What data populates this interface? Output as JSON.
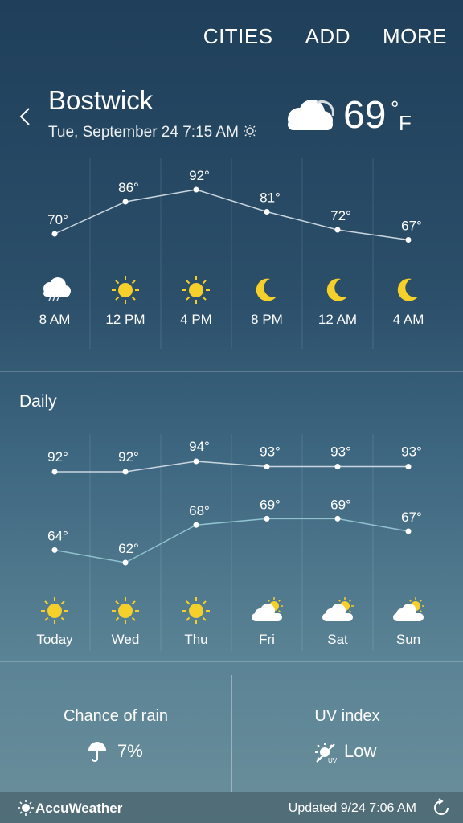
{
  "menu": {
    "cities": "CITIES",
    "add": "ADD",
    "more": "MORE"
  },
  "header": {
    "city": "Bostwick",
    "datetime": "Tue, September 24 7:15 AM",
    "current_temp": "69",
    "degree": "°",
    "unit": "F",
    "current_icon": "cloud-icon"
  },
  "hourly": [
    {
      "time": "8 AM",
      "temp": "70°",
      "value": 70,
      "icon": "rain-cloud-icon"
    },
    {
      "time": "12 PM",
      "temp": "86°",
      "value": 86,
      "icon": "sun-icon"
    },
    {
      "time": "4 PM",
      "temp": "92°",
      "value": 92,
      "icon": "sun-icon"
    },
    {
      "time": "8 PM",
      "temp": "81°",
      "value": 81,
      "icon": "moon-icon"
    },
    {
      "time": "12 AM",
      "temp": "72°",
      "value": 72,
      "icon": "moon-icon"
    },
    {
      "time": "4 AM",
      "temp": "67°",
      "value": 67,
      "icon": "moon-icon"
    }
  ],
  "daily_title": "Daily",
  "daily": [
    {
      "day": "Today",
      "high": "92°",
      "high_v": 92,
      "low": "64°",
      "low_v": 64,
      "icon": "sun-icon"
    },
    {
      "day": "Wed",
      "high": "92°",
      "high_v": 92,
      "low": "62°",
      "low_v": 62,
      "icon": "sun-icon"
    },
    {
      "day": "Thu",
      "high": "94°",
      "high_v": 94,
      "low": "68°",
      "low_v": 68,
      "icon": "sun-icon"
    },
    {
      "day": "Fri",
      "high": "93°",
      "high_v": 93,
      "low": "69°",
      "low_v": 69,
      "icon": "partly-cloudy-icon"
    },
    {
      "day": "Sat",
      "high": "93°",
      "high_v": 93,
      "low": "69°",
      "low_v": 69,
      "icon": "partly-cloudy-icon"
    },
    {
      "day": "Sun",
      "high": "93°",
      "high_v": 93,
      "low": "67°",
      "low_v": 67,
      "icon": "partly-cloudy-icon"
    }
  ],
  "rain": {
    "title": "Chance of rain",
    "value": "7%",
    "icon": "umbrella-icon"
  },
  "uv": {
    "title": "UV index",
    "value": "Low",
    "icon": "uv-sun-icon"
  },
  "footer": {
    "brand": "AccuWeather",
    "updated": "Updated 9/24  7:06 AM",
    "refresh_icon": "refresh-icon"
  },
  "colors": {
    "sun": "#f5cf2a",
    "moon": "#f5cf2a",
    "line": "#c9d6df",
    "low_line": "#8fc1cf"
  }
}
